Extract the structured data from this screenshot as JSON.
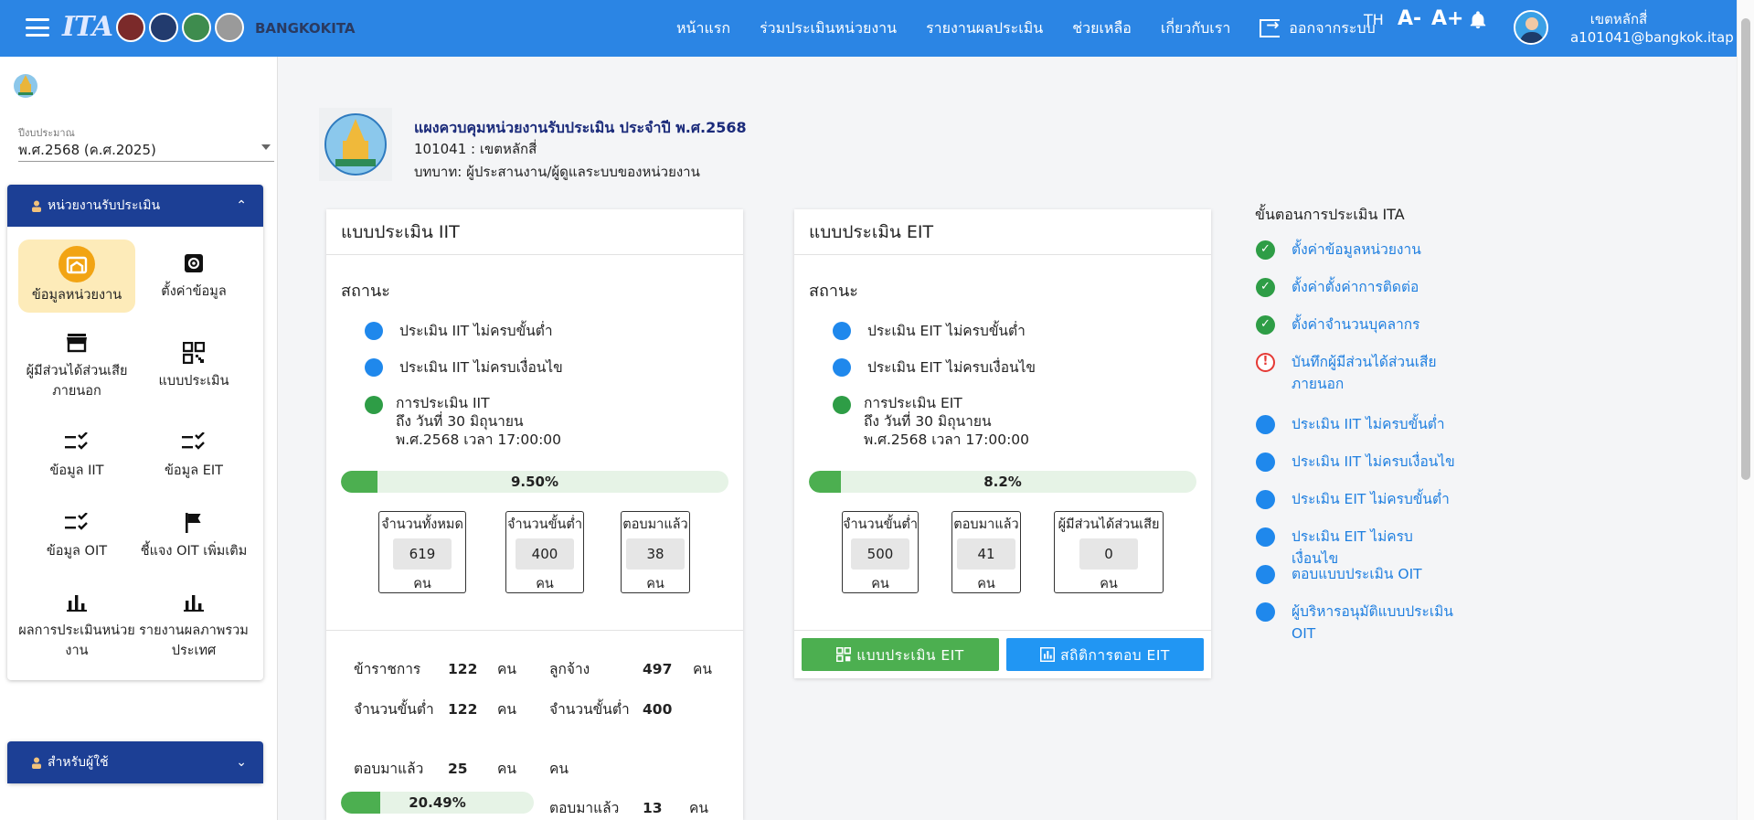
{
  "header": {
    "brand": "BANGKOKITA",
    "logo_text": "ITA",
    "nav": [
      "หน้าแรก",
      "ร่วมประเมินหน่วยงาน",
      "รายงานผลประเมิน",
      "ช่วยเหลือ",
      "เกี่ยวกับเรา"
    ],
    "logout": "ออกจากระบบ",
    "lang": "TH",
    "font_down": "A-",
    "font_up": "A+",
    "user_name": "เขตหลักสี่",
    "user_email": "a101041@bangkok.itap"
  },
  "sidebar": {
    "budget_label": "ปีงบประมาณ",
    "budget_value": "พ.ศ.2568 (ค.ศ.2025)",
    "panel1_title": "หน่วยงานรับประเมิน",
    "items": [
      {
        "label": "ข้อมูลหน่วยงาน",
        "icon": "home-icon"
      },
      {
        "label": "ตั้งค่าข้อมูล",
        "icon": "settings-icon"
      },
      {
        "label": "ผู้มีส่วนได้ส่วนเสียภายนอก",
        "icon": "store-icon"
      },
      {
        "label": "แบบประเมิน",
        "icon": "qr-icon"
      },
      {
        "label": "ข้อมูล IIT",
        "icon": "checklist-icon"
      },
      {
        "label": "ข้อมูล EIT",
        "icon": "checklist-icon"
      },
      {
        "label": "ข้อมูล OIT",
        "icon": "checklist-icon"
      },
      {
        "label": "ชี้แจง OIT เพิ่มเติม",
        "icon": "flag-icon"
      },
      {
        "label": "ผลการประเมินหน่วยงาน",
        "icon": "bar-chart-icon"
      },
      {
        "label": "รายงานผลภาพรวมประเทศ",
        "icon": "bar-chart-icon"
      }
    ],
    "panel2_title": "สำหรับผู้ใช้"
  },
  "main": {
    "title": "แผงควบคุมหน่วยงานรับประเมิน ประจำปี พ.ศ.2568",
    "org": "101041 : เขตหลักสี่",
    "role": "บทบาท: ผู้ประสานงาน/ผู้ดูแลระบบของหน่วยงาน"
  },
  "iit": {
    "title": "แบบประเมิน IIT",
    "status_label": "สถานะ",
    "s1": "ประเมิน IIT ไม่ครบขั้นต่ำ",
    "s2": "ประเมิน IIT ไม่ครบเงื่อนไข",
    "s3a": "การประเมิน IIT",
    "s3b": "ถึง วันที่ 30 มิถุนายน",
    "s3c": "พ.ศ.2568 เวลา 17:00:00",
    "progress_text": "9.50%",
    "progress": 9.5,
    "stats": [
      {
        "label": "จำนวนทั้งหมด",
        "value": "619",
        "unit": "คน"
      },
      {
        "label": "จำนวนขั้นต่ำ",
        "value": "400",
        "unit": "คน"
      },
      {
        "label": "ตอบมาแล้ว",
        "value": "38",
        "unit": "คน"
      }
    ],
    "gov_label": "ข้าราชการ",
    "gov_value": "122",
    "gov_unit": "คน",
    "emp_label": "ลูกจ้าง",
    "emp_value": "497",
    "emp_unit": "คน",
    "gov_min_label": "จำนวนขั้นต่ำ",
    "gov_min_value": "122",
    "gov_min_unit": "คน",
    "emp_min_label": "จำนวนขั้นต่ำ",
    "emp_min_value": "400",
    "emp_min_unit": "คน",
    "gov_resp_label": "ตอบมาแล้ว",
    "gov_resp_value": "25",
    "gov_resp_unit": "คน",
    "gov_progress_text": "20.49%",
    "gov_progress": 20.49,
    "emp_resp_label": "ตอบมาแล้ว",
    "emp_resp_value": "13",
    "emp_resp_unit": "คน"
  },
  "eit": {
    "title": "แบบประเมิน EIT",
    "status_label": "สถานะ",
    "s1": "ประเมิน EIT ไม่ครบขั้นต่ำ",
    "s2": "ประเมิน EIT ไม่ครบเงื่อนไข",
    "s3a": "การประเมิน EIT",
    "s3b": "ถึง วันที่ 30 มิถุนายน",
    "s3c": "พ.ศ.2568 เวลา 17:00:00",
    "progress_text": "8.2%",
    "progress": 8.2,
    "stats": [
      {
        "label": "จำนวนขั้นต่ำ",
        "value": "500",
        "unit": "คน"
      },
      {
        "label": "ตอบมาแล้ว",
        "value": "41",
        "unit": "คน"
      },
      {
        "label": "ผู้มีส่วนได้ส่วนเสีย",
        "value": "0",
        "unit": "คน"
      }
    ],
    "btn_form": "แบบประเมิน EIT",
    "btn_stats": "สถิติการตอบ EIT"
  },
  "steps": {
    "title": "ขั้นตอนการประเมิน ITA",
    "items": [
      {
        "label": "ตั้งค่าข้อมูลหน่วยงาน",
        "state": "done"
      },
      {
        "label": "ตั้งค่าตั้งค่าการติดต่อ",
        "state": "done"
      },
      {
        "label": "ตั้งค่าจำนวนบุคลากร",
        "state": "done"
      },
      {
        "label": "บันทึกผู้มีส่วนได้ส่วนเสียภายนอก",
        "state": "warn"
      },
      {
        "label": "ประเมิน IIT ไม่ครบขั้นต่ำ",
        "state": "todo"
      },
      {
        "label": "ประเมิน IIT ไม่ครบเงื่อนไข",
        "state": "todo"
      },
      {
        "label": "ประเมิน EIT ไม่ครบขั้นต่ำ",
        "state": "todo"
      },
      {
        "label": "ประเมิน EIT ไม่ครบเงื่อนไข",
        "state": "todo"
      },
      {
        "label": "ตอบแบบประเมิน OIT",
        "state": "todo"
      },
      {
        "label": "ผู้บริหารอนุมัติแบบประเมิน OIT",
        "state": "todo"
      }
    ]
  },
  "colors": {
    "topbar": "#2b85e4",
    "panel_head": "#1c3f95",
    "active_tile": "#fdebb9",
    "progress_fill": "#4caf50"
  }
}
